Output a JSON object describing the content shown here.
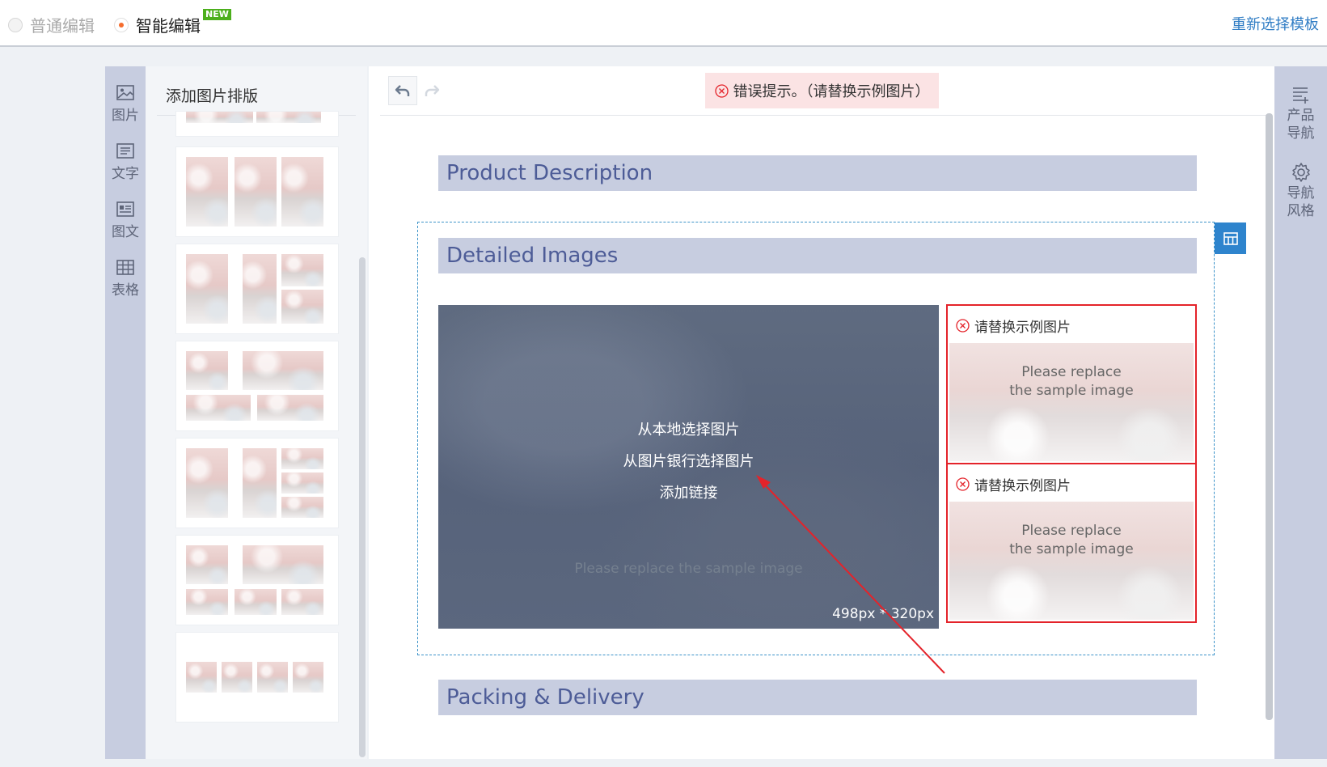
{
  "topbar": {
    "mode_normal": "普通编辑",
    "mode_smart": "智能编辑",
    "new_badge": "NEW",
    "reselect_template": "重新选择模板"
  },
  "left_tabs": [
    {
      "label": "图片",
      "icon": "image-icon"
    },
    {
      "label": "文字",
      "icon": "text-icon"
    },
    {
      "label": "图文",
      "icon": "image-text-icon"
    },
    {
      "label": "表格",
      "icon": "table-icon"
    }
  ],
  "layout_panel": {
    "title": "添加图片排版"
  },
  "editor": {
    "error_banner": "错误提示。（请替换示例图片）",
    "sections": {
      "product_description": "Product Description",
      "detailed_images": "Detailed Images",
      "packing_delivery": "Packing & Delivery"
    },
    "big_image": {
      "menu": [
        "从本地选择图片",
        "从图片银行选择图片",
        "添加链接"
      ],
      "watermark": "Please replace the sample image",
      "size": "498px * 320px"
    },
    "small_cards": [
      {
        "header": "请替换示例图片",
        "line1": "Please replace",
        "line2": "the sample image"
      },
      {
        "header": "请替换示例图片",
        "line1": "Please replace",
        "line2": "the sample image"
      }
    ]
  },
  "right_bar": [
    {
      "line1": "产品",
      "line2": "导航",
      "icon": "list-add-icon"
    },
    {
      "line1": "导航",
      "line2": "风格",
      "icon": "gear-icon"
    }
  ],
  "colors": {
    "accent_blue": "#2e84cd",
    "error_red": "#e4232a",
    "section_bg": "#c7cde0",
    "section_text": "#4d5c97"
  }
}
